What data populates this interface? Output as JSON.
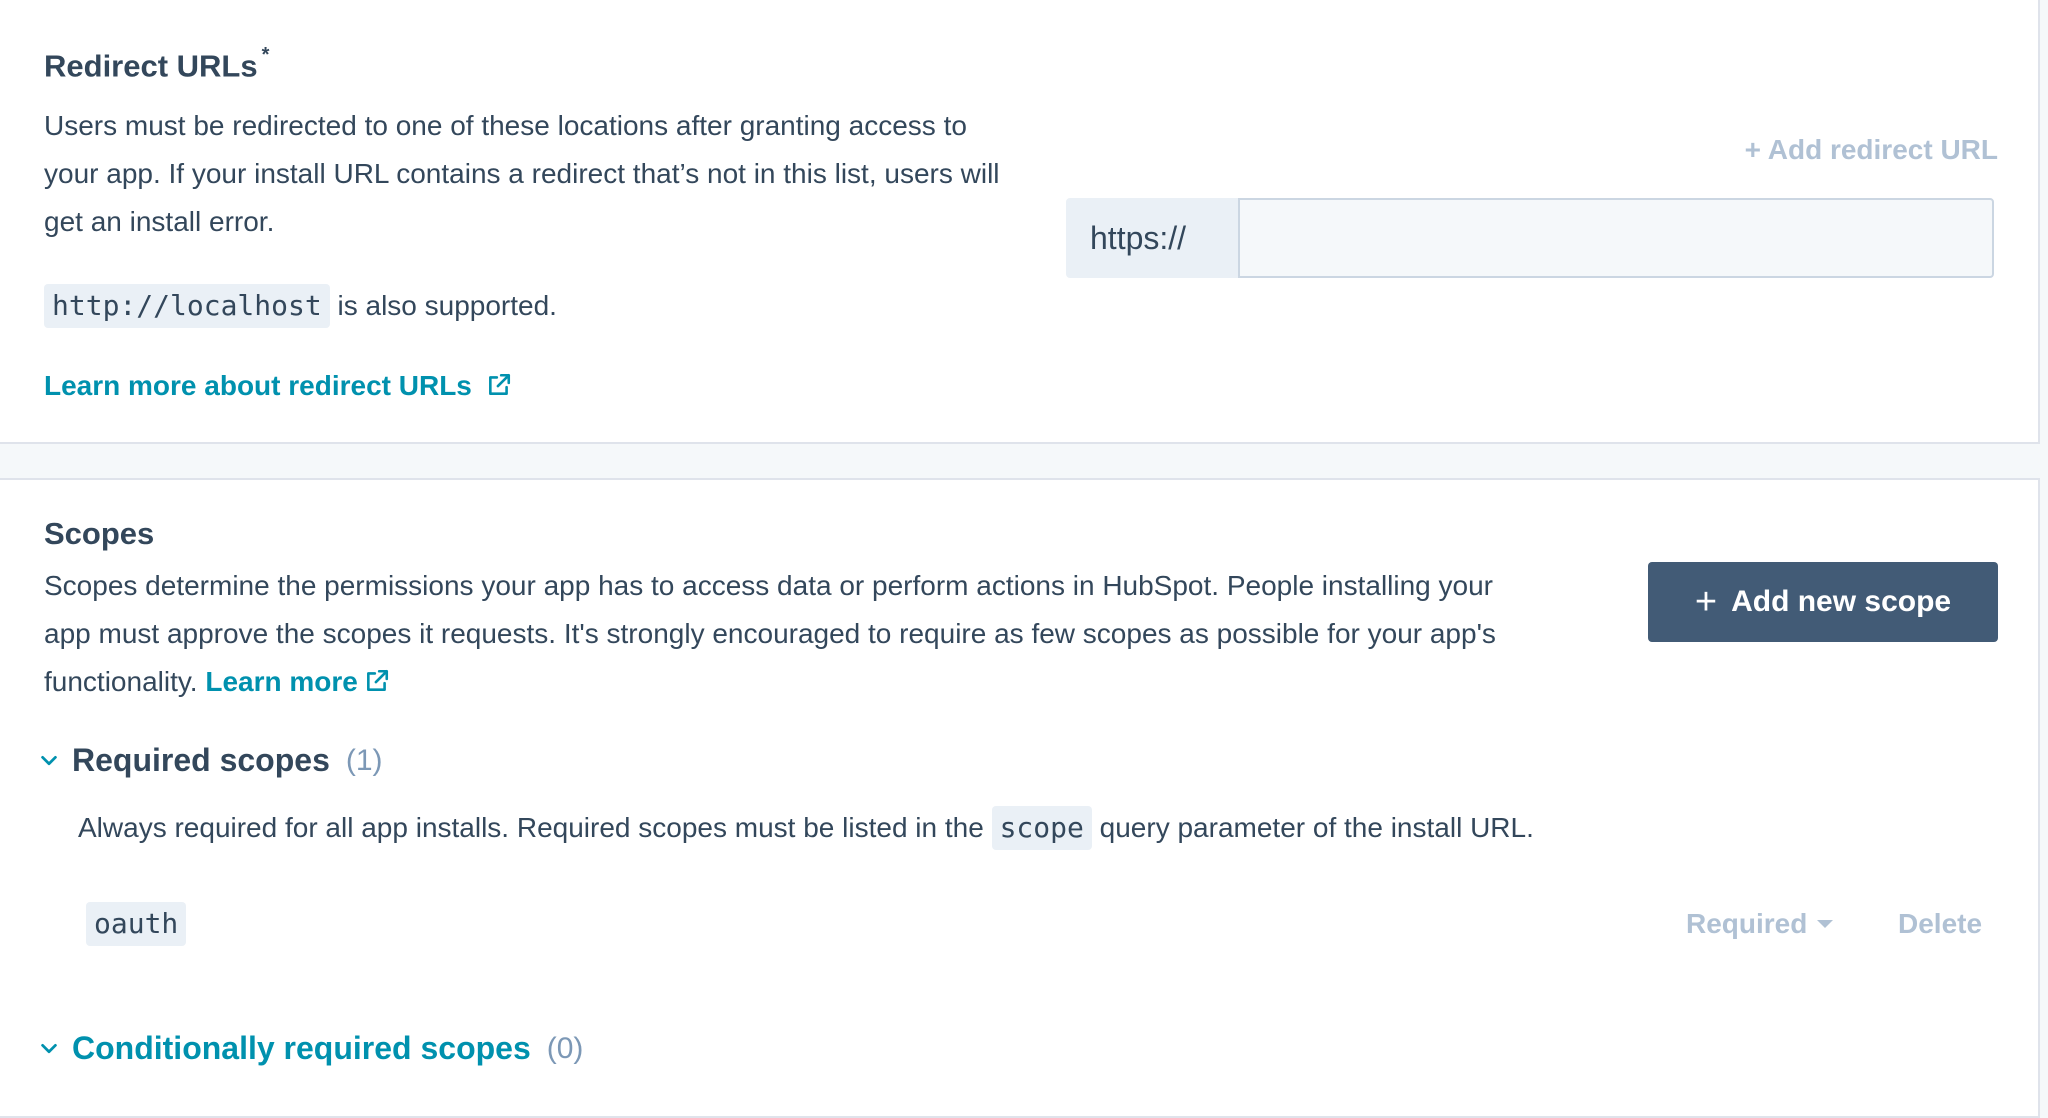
{
  "redirect": {
    "title": "Redirect URLs",
    "required_mark": "*",
    "description": "Users must be redirected to one of these locations after granting access to your app. If your install URL contains a redirect that’s not in this list, users will get an install error.",
    "localhost_code": "http://localhost",
    "localhost_suffix": "is also supported.",
    "learn_more": "Learn more about redirect URLs",
    "add_url_label": "+ Add redirect URL",
    "prefix": "https://",
    "input_value": ""
  },
  "scopes": {
    "title": "Scopes",
    "description": "Scopes determine the permissions your app has to access data or perform actions in HubSpot. People installing your app must approve the scopes it requests. It's strongly encouraged to require as few scopes as possible for your app's functionality.",
    "learn_more": "Learn more",
    "add_button": "Add new scope",
    "required": {
      "title": "Required scopes",
      "count": "(1)",
      "desc_before": "Always required for all app installs. Required scopes must be listed in the",
      "desc_code": "scope",
      "desc_after": "query parameter of the install URL.",
      "items": [
        {
          "name": "oauth",
          "status": "Required",
          "action": "Delete"
        }
      ]
    },
    "conditional": {
      "title": "Conditionally required scopes",
      "count": "(0)"
    }
  },
  "colors": {
    "primary_button": "#425b76",
    "link": "#0091ae",
    "text": "#33475b",
    "disabled": "#b0c1d4"
  },
  "icons": [
    "external-link-icon",
    "chevron-down-icon",
    "plus-icon",
    "caret-down-icon"
  ]
}
